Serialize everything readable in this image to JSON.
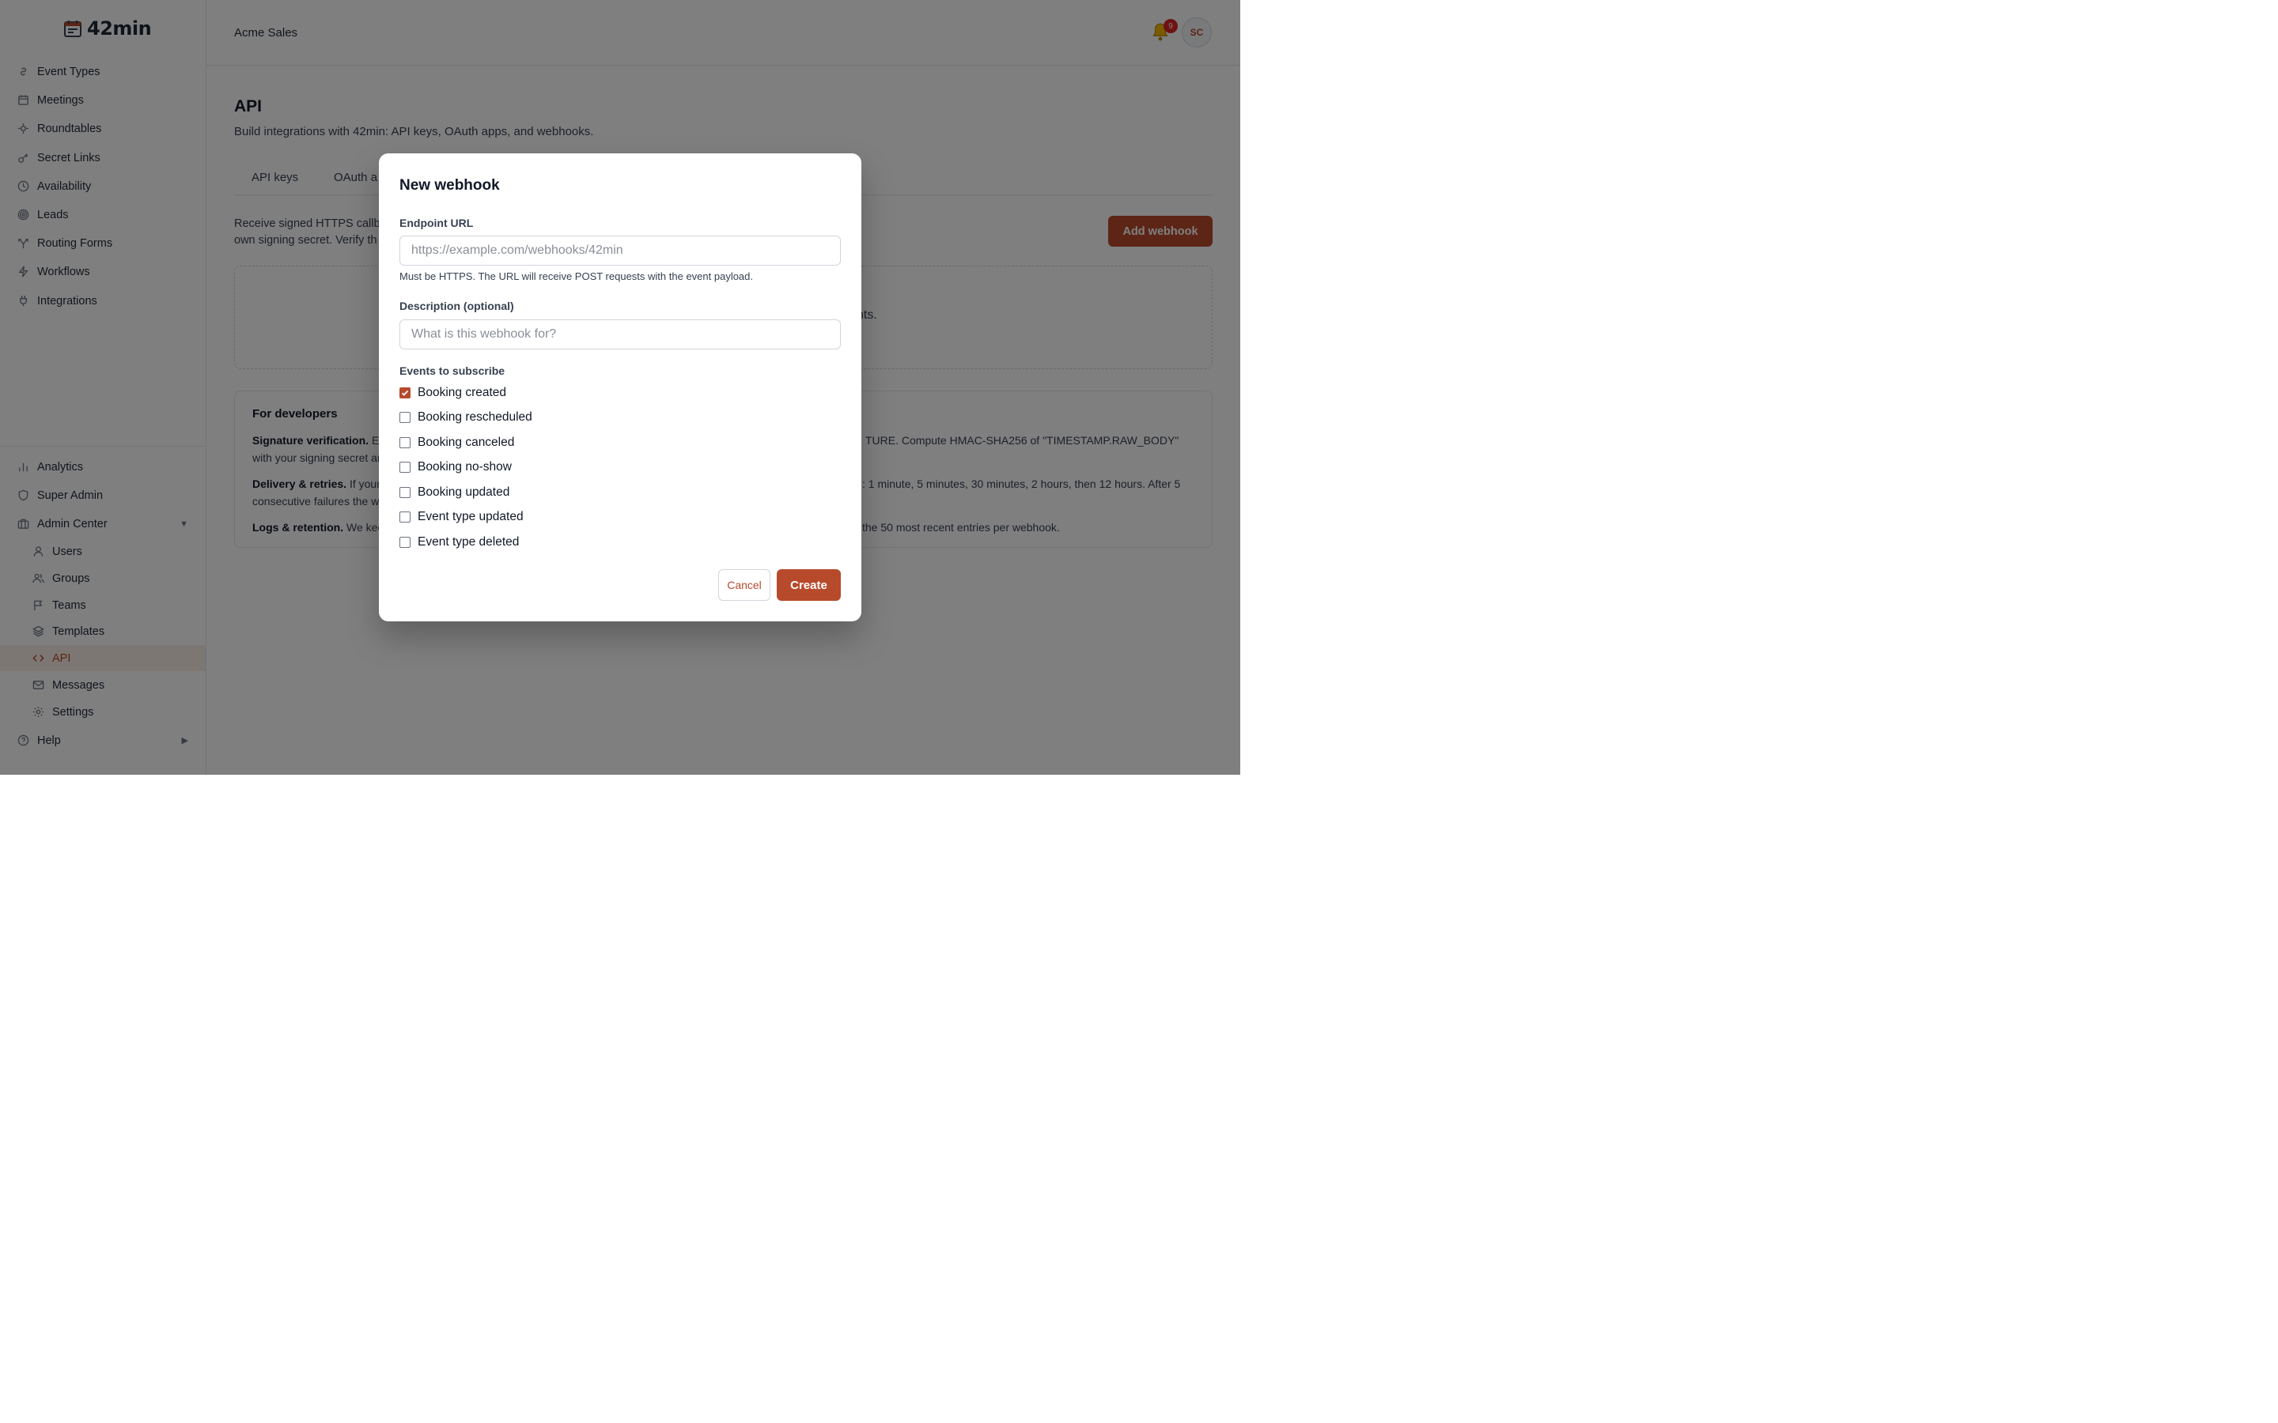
{
  "app": {
    "name": "42min"
  },
  "sidebar": {
    "items": [
      {
        "label": "Event Types",
        "icon": "link-icon"
      },
      {
        "label": "Meetings",
        "icon": "calendar-icon"
      },
      {
        "label": "Roundtables",
        "icon": "crosshair-icon"
      },
      {
        "label": "Secret Links",
        "icon": "key-icon"
      },
      {
        "label": "Availability",
        "icon": "clock-icon"
      },
      {
        "label": "Leads",
        "icon": "target-icon"
      },
      {
        "label": "Routing Forms",
        "icon": "split-icon"
      },
      {
        "label": "Workflows",
        "icon": "bolt-icon"
      },
      {
        "label": "Integrations",
        "icon": "plug-icon"
      }
    ],
    "bottom_items": [
      {
        "label": "Analytics",
        "icon": "bar-chart-icon"
      },
      {
        "label": "Super Admin",
        "icon": "shield-icon"
      },
      {
        "label": "Admin Center",
        "icon": "briefcase-icon",
        "expanded_arrow": "▼"
      }
    ],
    "admin_items": [
      {
        "label": "Users",
        "icon": "user-icon"
      },
      {
        "label": "Groups",
        "icon": "users-icon"
      },
      {
        "label": "Teams",
        "icon": "flag-icon"
      },
      {
        "label": "Templates",
        "icon": "layers-icon"
      },
      {
        "label": "API",
        "icon": "code-icon",
        "active": true
      },
      {
        "label": "Messages",
        "icon": "mail-icon"
      },
      {
        "label": "Settings",
        "icon": "gear-icon"
      }
    ],
    "help": {
      "label": "Help",
      "icon": "help-circle-icon",
      "arrow": "▶"
    }
  },
  "topbar": {
    "org_name": "Acme Sales",
    "notification_count": "9",
    "avatar_initials": "SC"
  },
  "page": {
    "title": "API",
    "subtitle": "Build integrations with 42min: API keys, OAuth apps, and webhooks.",
    "tabs": [
      "API keys",
      "OAuth a"
    ],
    "intro_line1": "Receive signed HTTPS callb",
    "intro_line2": "own signing secret. Verify th",
    "add_webhook_label": "Add webhook",
    "empty_text_fragment": "nts.",
    "developers": {
      "title": "For developers",
      "sig_heading": "Signature verification.",
      "sig_left": "E",
      "sig_right": "TURE. Compute HMAC-SHA256 of \"TIMESTAMP.RAW_BODY\"",
      "sig_line2": "with your signing secret ar",
      "delivery_heading": "Delivery & retries.",
      "delivery_left": "If your",
      "delivery_right": ": 1 minute, 5 minutes, 30 minutes, 2 hours, then 12 hours. After 5",
      "delivery_line2": "consecutive failures the w",
      "logs_heading": "Logs & retention.",
      "logs_left": "We kee",
      "logs_right": "the 50 most recent entries per webhook."
    }
  },
  "modal": {
    "title": "New webhook",
    "endpoint_label": "Endpoint URL",
    "endpoint_placeholder": "https://example.com/webhooks/42min",
    "endpoint_value": "",
    "endpoint_help": "Must be HTTPS. The URL will receive POST requests with the event payload.",
    "description_label": "Description (optional)",
    "description_placeholder": "What is this webhook for?",
    "description_value": "",
    "events_label": "Events to subscribe",
    "events": [
      {
        "label": "Booking created",
        "checked": true
      },
      {
        "label": "Booking rescheduled",
        "checked": false
      },
      {
        "label": "Booking canceled",
        "checked": false
      },
      {
        "label": "Booking no-show",
        "checked": false
      },
      {
        "label": "Booking updated",
        "checked": false
      },
      {
        "label": "Event type updated",
        "checked": false
      },
      {
        "label": "Event type deleted",
        "checked": false
      }
    ],
    "cancel_label": "Cancel",
    "create_label": "Create"
  },
  "colors": {
    "accent": "#b84a2c",
    "badge": "#dc2626"
  }
}
